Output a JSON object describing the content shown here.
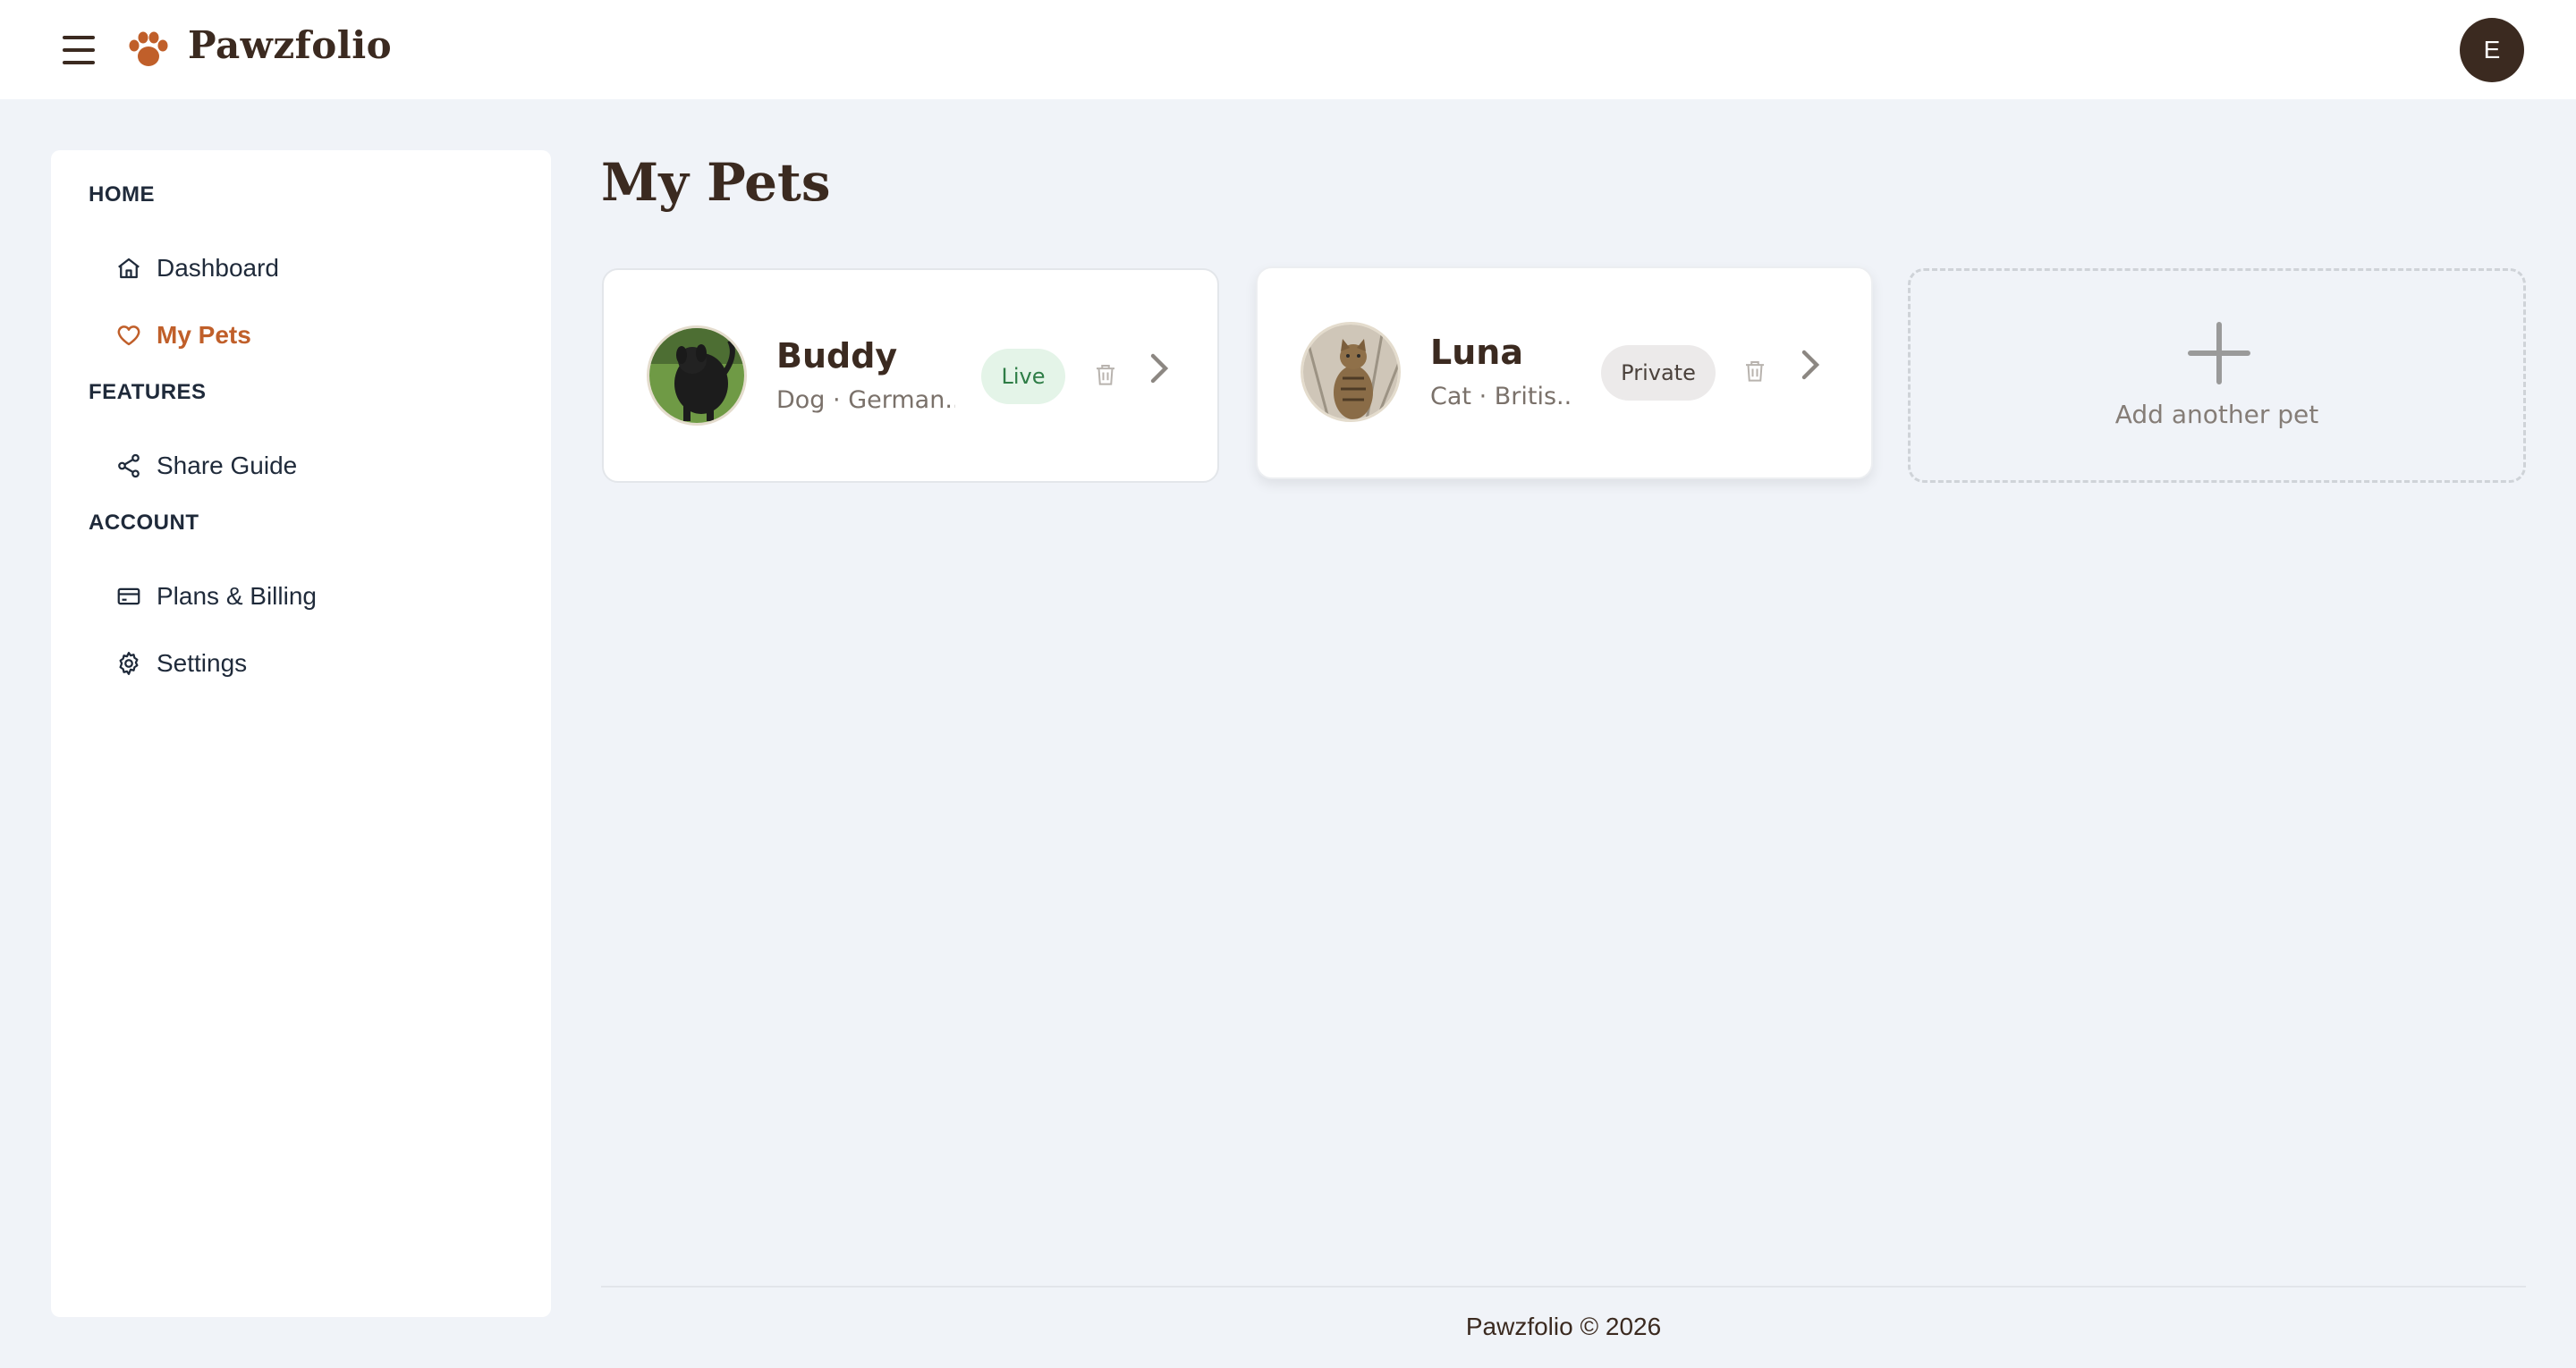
{
  "app": {
    "brand": "Pawzfolio",
    "user_initial": "E",
    "colors": {
      "accent": "#c05f2a",
      "brand_dark": "#3b2a20",
      "live_badge": "#2e7d46"
    }
  },
  "sidebar": {
    "sections": [
      {
        "heading": "HOME",
        "items": [
          {
            "label": "Dashboard",
            "icon": "home-icon",
            "active": false
          },
          {
            "label": "My Pets",
            "icon": "heart-icon",
            "active": true
          }
        ]
      },
      {
        "heading": "FEATURES",
        "items": [
          {
            "label": "Share Guide",
            "icon": "share-icon",
            "active": false
          }
        ]
      },
      {
        "heading": "ACCOUNT",
        "items": [
          {
            "label": "Plans & Billing",
            "icon": "credit-card-icon",
            "active": false
          },
          {
            "label": "Settings",
            "icon": "gear-icon",
            "active": false
          }
        ]
      }
    ]
  },
  "main": {
    "title": "My Pets",
    "pets": [
      {
        "name": "Buddy",
        "subtitle": "Dog · German...",
        "status": "Live"
      },
      {
        "name": "Luna",
        "subtitle": "Cat · Britis...",
        "status": "Private"
      }
    ],
    "add_label": "Add another pet"
  },
  "footer": {
    "text": "Pawzfolio © 2026"
  }
}
